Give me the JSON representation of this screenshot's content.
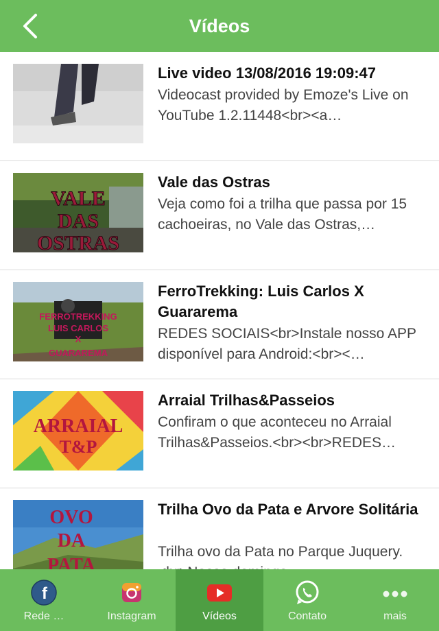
{
  "header": {
    "title": "Vídeos",
    "back_icon": "chevron-left-icon"
  },
  "videos": [
    {
      "title": "Live video 13/08/2016 19:09:47",
      "description": "Videocast provided by Emoze's Live on YouTube 1.2.11448<br><a…"
    },
    {
      "title": "Vale das Ostras",
      "description": "Veja como foi a trilha que passa por 15 cachoeiras, no Vale das Ostras,…",
      "thumb_text": [
        "VALE",
        "DAS",
        "OSTRAS"
      ]
    },
    {
      "title": "FerroTrekking: Luis Carlos X Guararema",
      "description": "REDES SOCIAIS<br>Instale nosso APP disponível para Android:<br><…",
      "thumb_text": [
        "FERROTREKKING",
        "LUIS CARLOS",
        "X",
        "GUARAREMA"
      ]
    },
    {
      "title": "Arraial Trilhas&Passeios",
      "description": "Confiram o que aconteceu no Arraial Trilhas&Passeios.<br><br>REDES…",
      "thumb_text": [
        "ARRAIAL",
        "T&P"
      ]
    },
    {
      "title": "Trilha Ovo da Pata e Arvore Solitária",
      "description": "Trilha ovo da Pata no Parque Juquery.<br>Nosso domingo…",
      "thumb_text": [
        "OVO",
        "DA",
        "PATA"
      ]
    }
  ],
  "tabs": [
    {
      "label": "Rede …",
      "icon": "facebook-icon"
    },
    {
      "label": "Instagram",
      "icon": "instagram-icon"
    },
    {
      "label": "Vídeos",
      "icon": "youtube-icon",
      "active": true
    },
    {
      "label": "Contato",
      "icon": "whatsapp-icon"
    },
    {
      "label": "mais",
      "icon": "more-dots-icon"
    }
  ],
  "colors": {
    "brand_green": "#6cbd5d",
    "active_tab": "#4e9e43"
  }
}
